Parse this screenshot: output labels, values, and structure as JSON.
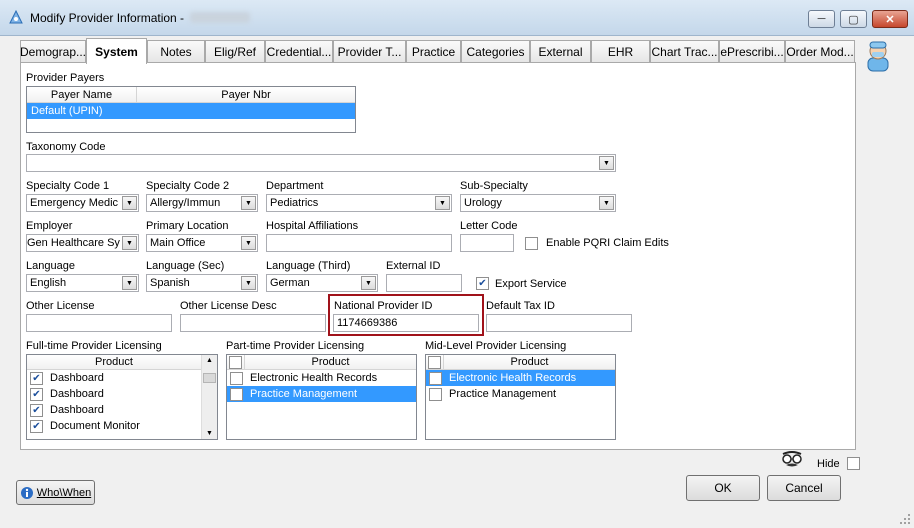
{
  "window": {
    "title": "Modify Provider Information -",
    "minimize": "─",
    "maximize": "▢",
    "close": "✕"
  },
  "tabs": [
    "Demograp...",
    "System",
    "Notes",
    "Elig/Ref",
    "Credential...",
    "Provider T...",
    "Practice",
    "Categories",
    "External",
    "EHR",
    "Chart Trac...",
    "ePrescribi...",
    "Order Mod..."
  ],
  "active_tab": "System",
  "provider_payers": {
    "label": "Provider Payers",
    "columns": [
      "Payer Name",
      "Payer Nbr"
    ],
    "rows": [
      {
        "name": "Default (UPIN)",
        "nbr": ""
      }
    ]
  },
  "taxonomy": {
    "label": "Taxonomy Code",
    "value": ""
  },
  "specialty1": {
    "label": "Specialty Code 1",
    "value": "Emergency Medic"
  },
  "specialty2": {
    "label": "Specialty Code 2",
    "value": "Allergy/Immun"
  },
  "department": {
    "label": "Department",
    "value": "Pediatrics"
  },
  "subspecialty": {
    "label": "Sub-Specialty",
    "value": "Urology"
  },
  "employer": {
    "label": "Employer",
    "value": "Gen Healthcare Syst"
  },
  "primary_location": {
    "label": "Primary Location",
    "value": "Main Office"
  },
  "hospital_affiliations": {
    "label": "Hospital Affiliations",
    "value": ""
  },
  "letter_code": {
    "label": "Letter Code",
    "value": ""
  },
  "enable_pqri": {
    "label": "Enable PQRI Claim Edits",
    "checked": false
  },
  "language": {
    "label": "Language",
    "value": "English"
  },
  "language_sec": {
    "label": "Language (Sec)",
    "value": "Spanish"
  },
  "language_third": {
    "label": "Language (Third)",
    "value": "German"
  },
  "external_id": {
    "label": "External ID",
    "value": ""
  },
  "export_service": {
    "label": "Export Service",
    "checked": true
  },
  "other_license": {
    "label": "Other License",
    "value": ""
  },
  "other_license_desc": {
    "label": "Other License Desc",
    "value": ""
  },
  "npi": {
    "label": "National Provider ID",
    "value": "1174669386"
  },
  "default_tax_id": {
    "label": "Default Tax ID",
    "value": ""
  },
  "fulltime": {
    "label": "Full-time Provider Licensing",
    "header": "Product",
    "items": [
      {
        "text": "Dashboard",
        "checked": true
      },
      {
        "text": "Dashboard",
        "checked": true
      },
      {
        "text": "Dashboard",
        "checked": true
      },
      {
        "text": "Document Monitor",
        "checked": true
      }
    ]
  },
  "parttime": {
    "label": "Part-time Provider Licensing",
    "header": "Product",
    "items": [
      {
        "text": "Electronic Health Records",
        "checked": false
      },
      {
        "text": "Practice Management",
        "checked": false
      }
    ]
  },
  "midlevel": {
    "label": "Mid-Level Provider Licensing",
    "header": "Product",
    "items": [
      {
        "text": "Electronic Health Records",
        "checked": false
      },
      {
        "text": "Practice Management",
        "checked": false
      }
    ]
  },
  "hide": {
    "label": "Hide"
  },
  "buttons": {
    "whowhen": "Who\\When",
    "ok": "OK",
    "cancel": "Cancel"
  }
}
